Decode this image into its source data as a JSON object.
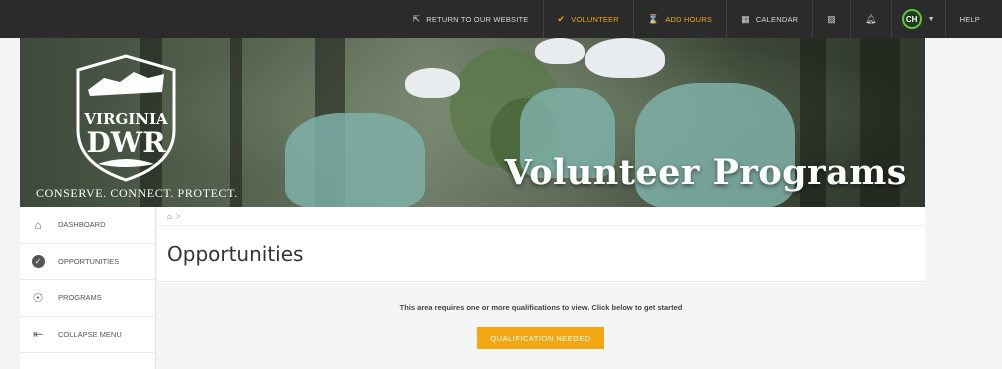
{
  "topbar": {
    "items": [
      {
        "label": "RETURN TO OUR WEBSITE",
        "icon": "external-link-icon"
      },
      {
        "label": "VOLUNTEER",
        "icon": "check-circle-icon",
        "accent": true
      },
      {
        "label": "ADD HOURS",
        "icon": "hourglass-icon",
        "accent": true
      },
      {
        "label": "CALENDAR",
        "icon": "calendar-icon"
      }
    ],
    "avatar_initials": "CH",
    "help_label": "HELP"
  },
  "banner": {
    "logo_line1": "VIRGINIA",
    "logo_line2": "DWR",
    "tagline": "CONSERVE. CONNECT. PROTECT.",
    "title": "Volunteer Programs"
  },
  "sidebar": {
    "items": [
      {
        "label": "DASHBOARD",
        "icon": "home-icon"
      },
      {
        "label": "OPPORTUNITIES",
        "icon": "check-circle-icon"
      },
      {
        "label": "PROGRAMS",
        "icon": "hand-heart-icon"
      },
      {
        "label": "COLLAPSE MENU",
        "icon": "collapse-icon"
      }
    ]
  },
  "main": {
    "breadcrumb_sep": ">",
    "page_title": "Opportunities",
    "notice": "This area requires one or more qualifications to view. Click below to get started",
    "button_label": "QUALIFICATION NEEDED"
  },
  "colors": {
    "accent": "#f3a712",
    "topbar_bg": "#2b2b2b",
    "avatar_ring": "#64c23c"
  }
}
